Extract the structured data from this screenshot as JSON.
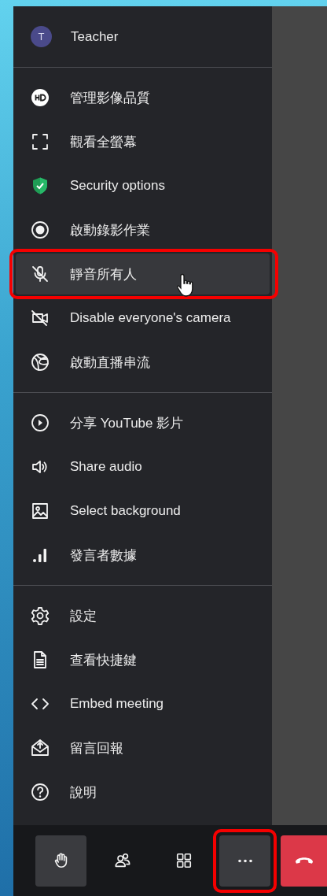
{
  "user": {
    "initial": "T",
    "name": "Teacher"
  },
  "menu_sections": [
    [
      {
        "label": "管理影像品質",
        "highlighted": false
      },
      {
        "label": "觀看全螢幕",
        "highlighted": false
      },
      {
        "label": "Security options",
        "highlighted": false
      },
      {
        "label": "啟動錄影作業",
        "highlighted": false
      },
      {
        "label": "靜音所有人",
        "highlighted": true
      },
      {
        "label": "Disable everyone's camera",
        "highlighted": false
      },
      {
        "label": "啟動直播串流",
        "highlighted": false
      }
    ],
    [
      {
        "label": "分享 YouTube 影片",
        "highlighted": false
      },
      {
        "label": "Share audio",
        "highlighted": false
      },
      {
        "label": "Select background",
        "highlighted": false
      },
      {
        "label": "發言者數據",
        "highlighted": false
      }
    ],
    [
      {
        "label": "設定",
        "highlighted": false
      },
      {
        "label": "查看快捷鍵",
        "highlighted": false
      },
      {
        "label": "Embed meeting",
        "highlighted": false
      },
      {
        "label": "留言回報",
        "highlighted": false
      },
      {
        "label": "說明",
        "highlighted": false
      }
    ]
  ],
  "toolbar": [
    {
      "kind": "hand",
      "active": true
    },
    {
      "kind": "participants",
      "active": false
    },
    {
      "kind": "tiles",
      "active": false
    },
    {
      "kind": "more",
      "active": true,
      "highlighted": true
    },
    {
      "kind": "hangup"
    }
  ]
}
